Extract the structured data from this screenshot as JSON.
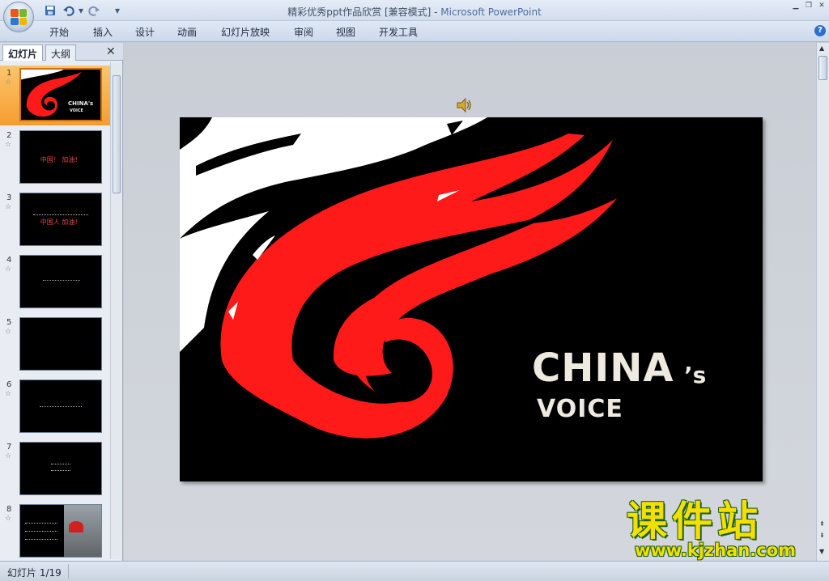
{
  "window": {
    "title": "精彩优秀ppt作品欣赏 [兼容模式]",
    "separator": " - ",
    "app": "Microsoft PowerPoint"
  },
  "quick_access": {
    "save_icon": "save-icon",
    "undo_icon": "undo-icon",
    "redo_icon": "redo-icon",
    "customize_icon": "dropdown-icon"
  },
  "ribbon": {
    "tabs": [
      "开始",
      "插入",
      "设计",
      "动画",
      "幻灯片放映",
      "审阅",
      "视图",
      "开发工具"
    ]
  },
  "left_pane": {
    "tabs": [
      "幻灯片",
      "大纲"
    ],
    "close_glyph": "✕",
    "thumbnails": [
      {
        "num": "1",
        "selected": true
      },
      {
        "num": "2",
        "selected": false,
        "text": "中国！ 加油！"
      },
      {
        "num": "3",
        "selected": false,
        "text": "中国人 加油！"
      },
      {
        "num": "4",
        "selected": false
      },
      {
        "num": "5",
        "selected": false
      },
      {
        "num": "6",
        "selected": false
      },
      {
        "num": "7",
        "selected": false
      },
      {
        "num": "8",
        "selected": false
      }
    ],
    "star_glyph": "☆"
  },
  "slide": {
    "title_main": "CHINA",
    "title_apos": "’s",
    "subtitle": "VOICE",
    "thumb_title": "CHINA's",
    "thumb_subtitle": "VOICE"
  },
  "watermark": {
    "cn": "课件站",
    "url": "www.kjzhan.com"
  },
  "status": {
    "slide_counter": "幻灯片 1/19"
  },
  "colors": {
    "accent_red": "#ff1a1a",
    "selection_orange": "#f59e2f",
    "watermark_yellow": "#f4e000"
  }
}
